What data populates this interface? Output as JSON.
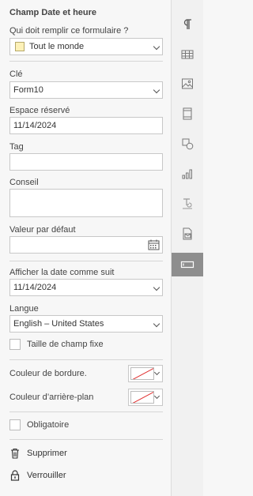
{
  "panel": {
    "title": "Champ Date et heure",
    "who_fills_label": "Qui doit remplir ce formulaire ?",
    "who_fills_value": "Tout le monde",
    "key_label": "Clé",
    "key_value": "Form10",
    "placeholder_label": "Espace réservé",
    "placeholder_value": "11/14/2024",
    "tag_label": "Tag",
    "tag_value": "",
    "tip_label": "Conseil",
    "tip_value": "",
    "default_label": "Valeur par défaut",
    "default_value": "",
    "display_label": "Afficher la date comme suit",
    "display_value": "11/14/2024",
    "lang_label": "Langue",
    "lang_value": "English – United States",
    "fixed_size_label": "Taille de champ fixe",
    "border_color_label": "Couleur de bordure.",
    "bg_color_label": "Couleur d’arrière-plan",
    "required_label": "Obligatoire",
    "delete_label": "Supprimer",
    "lock_label": "Verrouiller",
    "fixed_size_checked": false,
    "required_checked": false,
    "swatch_color": "#fdf1b8"
  },
  "rail": {
    "items": [
      "paragraph-icon",
      "table-icon",
      "image-icon",
      "header-footer-icon",
      "shape-icon",
      "chart-icon",
      "text-art-icon",
      "mail-merge-icon",
      "form-field-icon"
    ],
    "active_index": 8,
    "active_color": "#8e8e8e"
  }
}
